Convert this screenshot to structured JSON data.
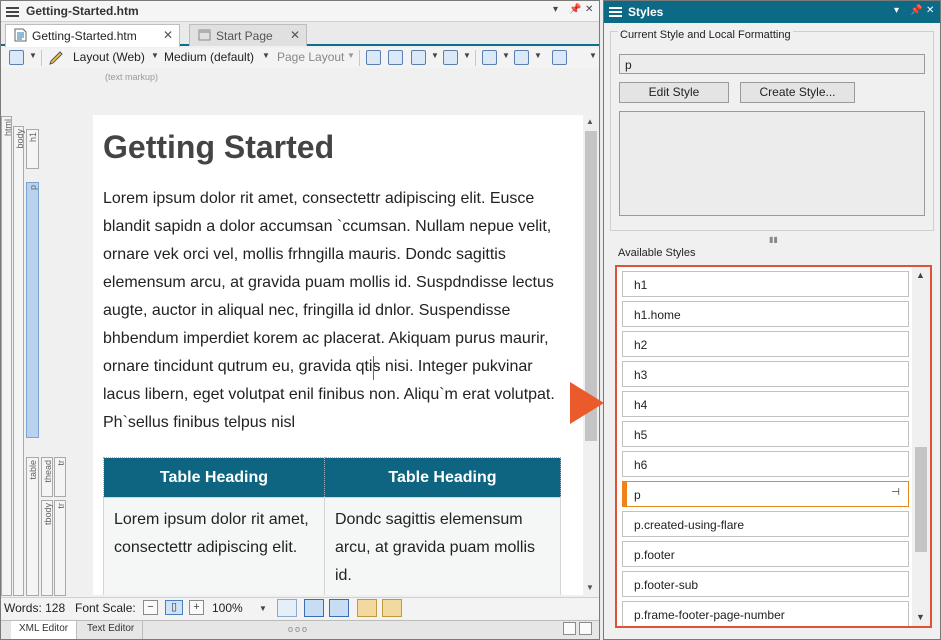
{
  "editor": {
    "title": "Getting-Started.htm",
    "window_controls": [
      "▾",
      "📌",
      "✕"
    ],
    "tabs": [
      {
        "label": "Getting-Started.htm",
        "close": "✕"
      },
      {
        "label": "Start Page",
        "close": "✕"
      }
    ],
    "toolbar": {
      "layout": "Layout (Web)",
      "medium": "Medium (default)",
      "page_layout": "Page Layout"
    },
    "markup_note": "(text markup)",
    "structure_bars": [
      "html",
      "body",
      "h1",
      "p",
      "table",
      "thead",
      "tr",
      "tbody",
      "tr"
    ],
    "page": {
      "heading": "Getting Started",
      "paragraph": "Lorem ipsum dolor rit amet, consectettr adipiscing elit. Eusce blandit sapidn a dolor accumsan `ccumsan. Nullam nepue velit, ornare vek orci vel, mollis frhngilla mauris. Dondc sagittis elemensum arcu, at gravida puam mollis id. Suspdndisse lectus augte, auctor in aliqual nec, fringilla id dnlor. Suspendisse bhbendum imperdiet korem ac placerat. Akiquam purus maurir, ornare tincidunt qutrum eu, gravida qtis nisi. Integer pukvinar lacus libern, eget volutpat enil finibus non. Aliqu`m erat volutpat. Ph`sellus finibus telpus nisl",
      "table_headers": [
        "Table Heading",
        "Table Heading"
      ],
      "table_cells": [
        "Lorem ipsum dolor rit amet, consectettr adipiscing elit.",
        "Dondc sagittis elemensum arcu, at gravida puam mollis id."
      ]
    },
    "status": {
      "words": "Words: 128",
      "font_scale": "Font Scale:",
      "zoom": "100%"
    },
    "bottom_tabs": [
      "XML Editor",
      "Text Editor"
    ],
    "bottom_dots": "ooo"
  },
  "styles_pane": {
    "title": "Styles",
    "window_controls": [
      "▾",
      "📌",
      "✕"
    ],
    "current_label": "Current Style and Local Formatting",
    "current_value": "p",
    "edit_button": "Edit Style",
    "create_button": "Create Style...",
    "available_label": "Available Styles",
    "items": [
      "h1",
      "h1.home",
      "h2",
      "h3",
      "h4",
      "h5",
      "h6",
      "p",
      "p.created-using-flare",
      "p.footer",
      "p.footer-sub",
      "p.frame-footer-page-number"
    ],
    "selected_item": "p",
    "pin_glyph": "⊣"
  },
  "colors": {
    "accent": "#0d6a87",
    "table_header": "#0e6582",
    "highlight": "#e05232",
    "selected_marker": "#f0821a"
  }
}
